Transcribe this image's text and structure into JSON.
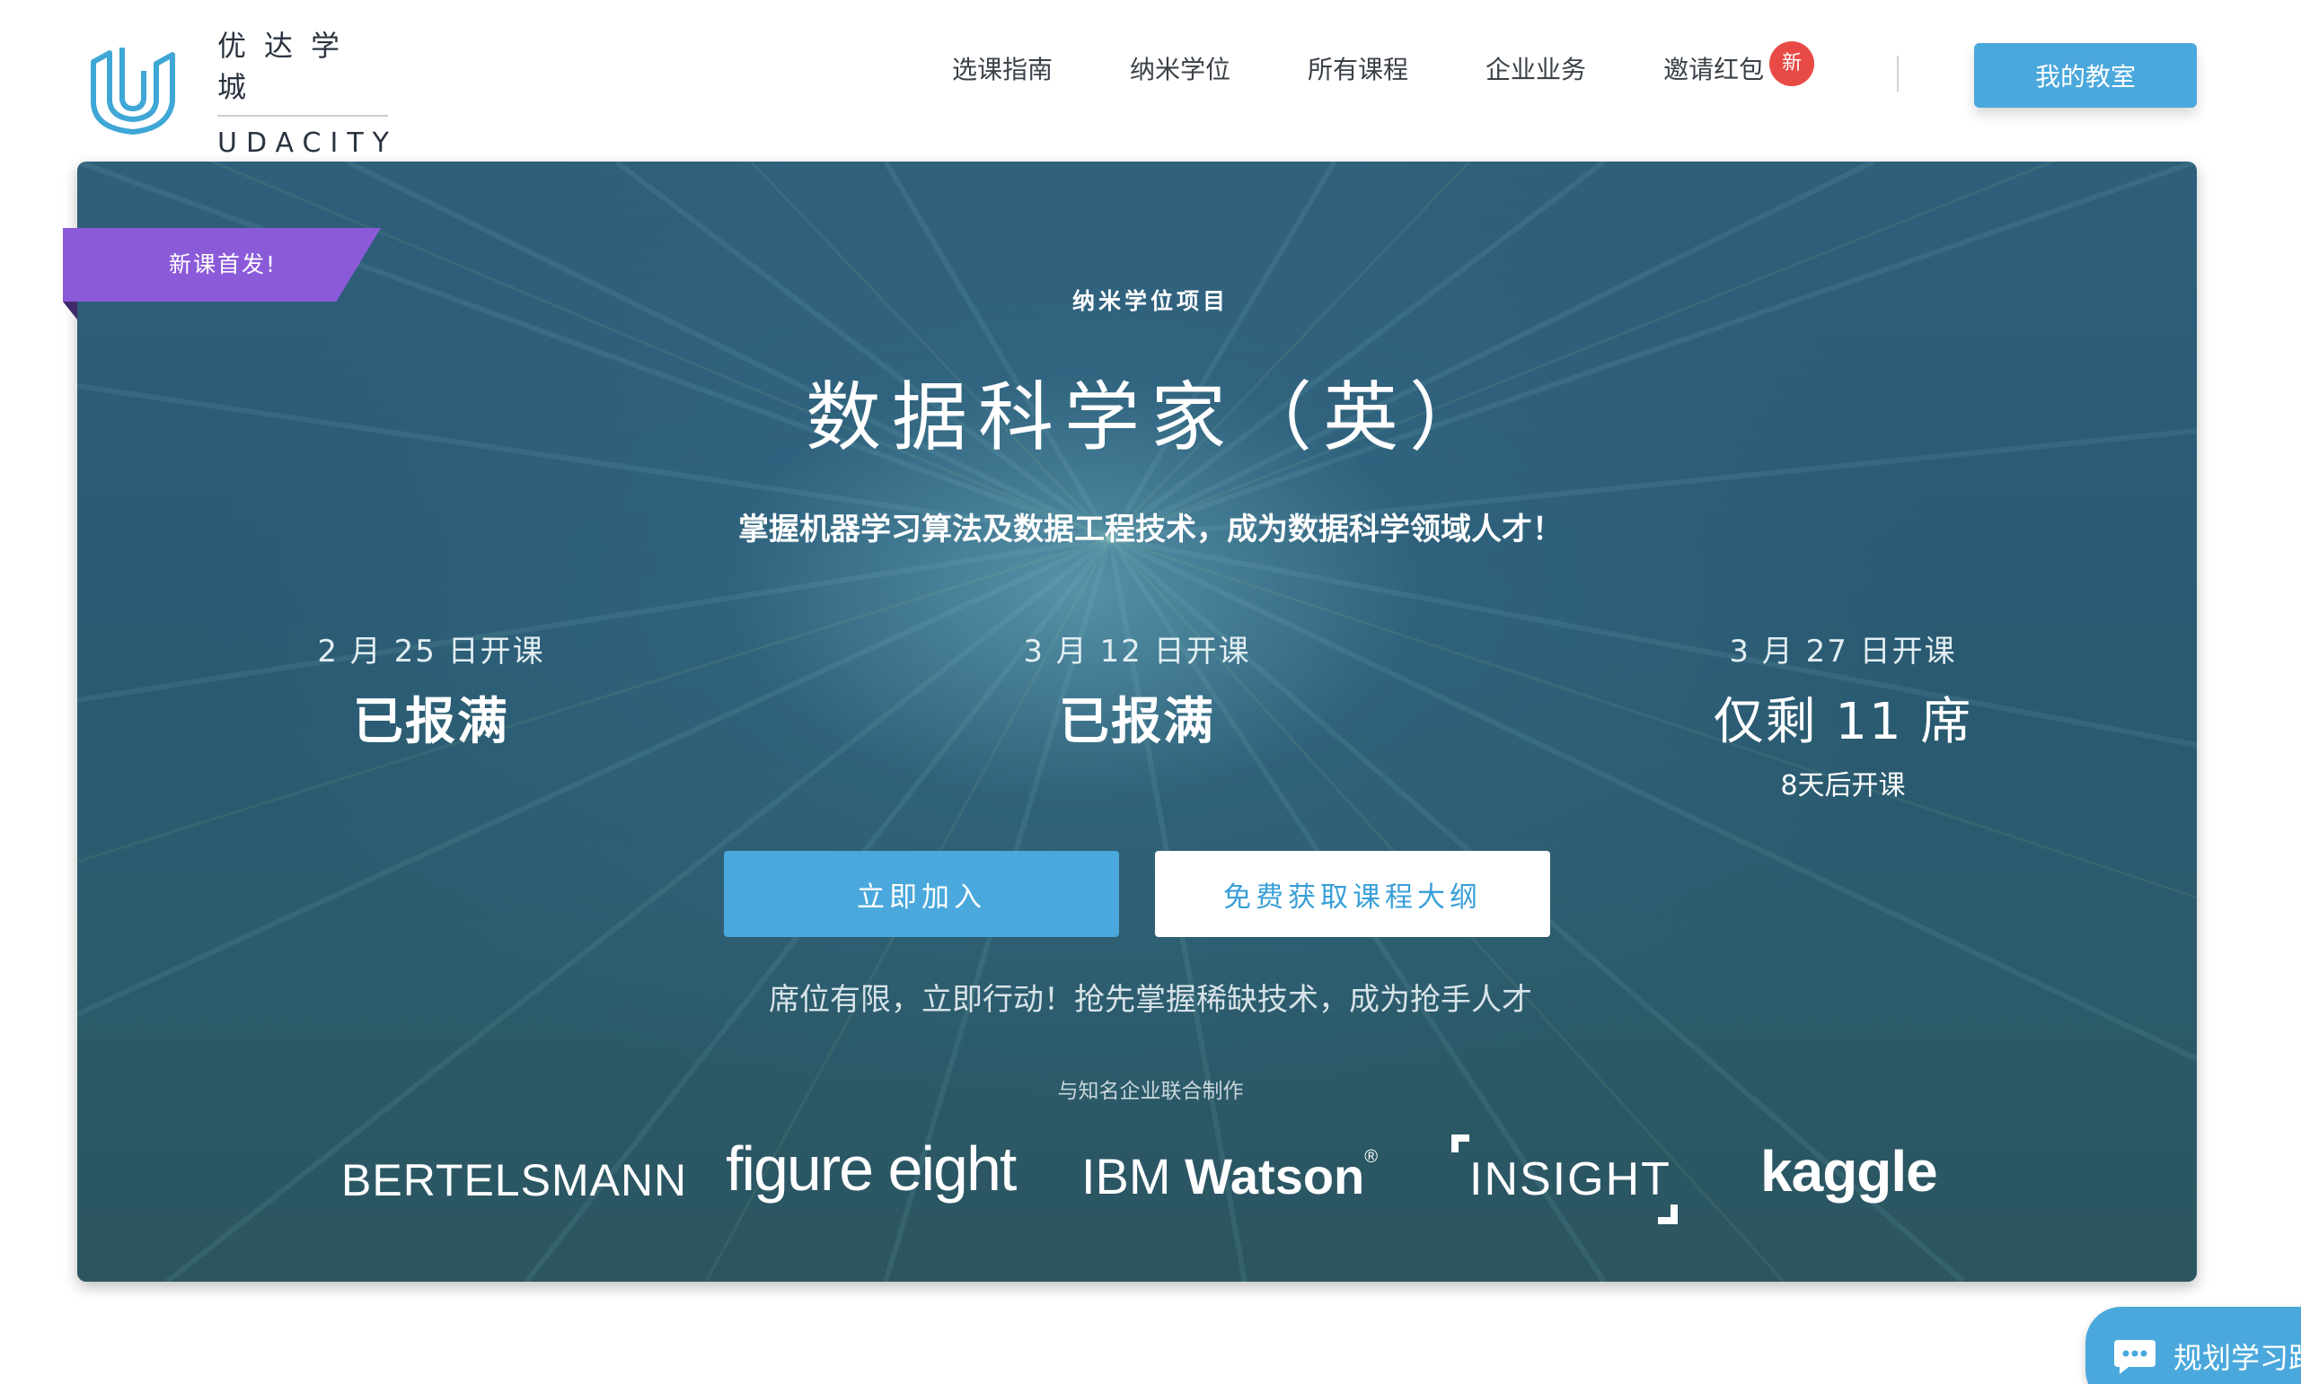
{
  "header": {
    "logo_cn": "优达学城",
    "logo_en": "UDACITY",
    "nav": [
      {
        "label": "选课指南"
      },
      {
        "label": "纳米学位"
      },
      {
        "label": "所有课程"
      },
      {
        "label": "企业业务"
      },
      {
        "label": "邀请红包",
        "badge": "新"
      }
    ],
    "classroom_button": "我的教室"
  },
  "hero": {
    "ribbon": "新课首发!",
    "program_type": "纳米学位项目",
    "title": "数据科学家（英）",
    "subtitle": "掌握机器学习算法及数据工程技术，成为数据科学领域人才！",
    "sessions": [
      {
        "date": "2 月 25 日开课",
        "status": "已报满"
      },
      {
        "date": "3 月 12 日开课",
        "status": "已报满"
      },
      {
        "date": "3 月 27 日开课",
        "status": "仅剩 11 席",
        "note": "8天后开课"
      }
    ],
    "join_button": "立即加入",
    "syllabus_button": "免费获取课程大纲",
    "urgency": "席位有限，立即行动！抢先掌握稀缺技术，成为抢手人才",
    "partners_label": "与知名企业联合制作",
    "partners": {
      "bertelsmann": "BERTELSMANN",
      "figure_eight": "figure eight",
      "ibm": "IBM",
      "watson": "Watson",
      "registered": "®",
      "insight": "INSIGHT",
      "kaggle": "kaggle"
    }
  },
  "chat": {
    "label": "规划学习路"
  },
  "colors": {
    "accent": "#4aa8dc",
    "ribbon": "#8b5ad8",
    "badge": "#e84b46"
  }
}
